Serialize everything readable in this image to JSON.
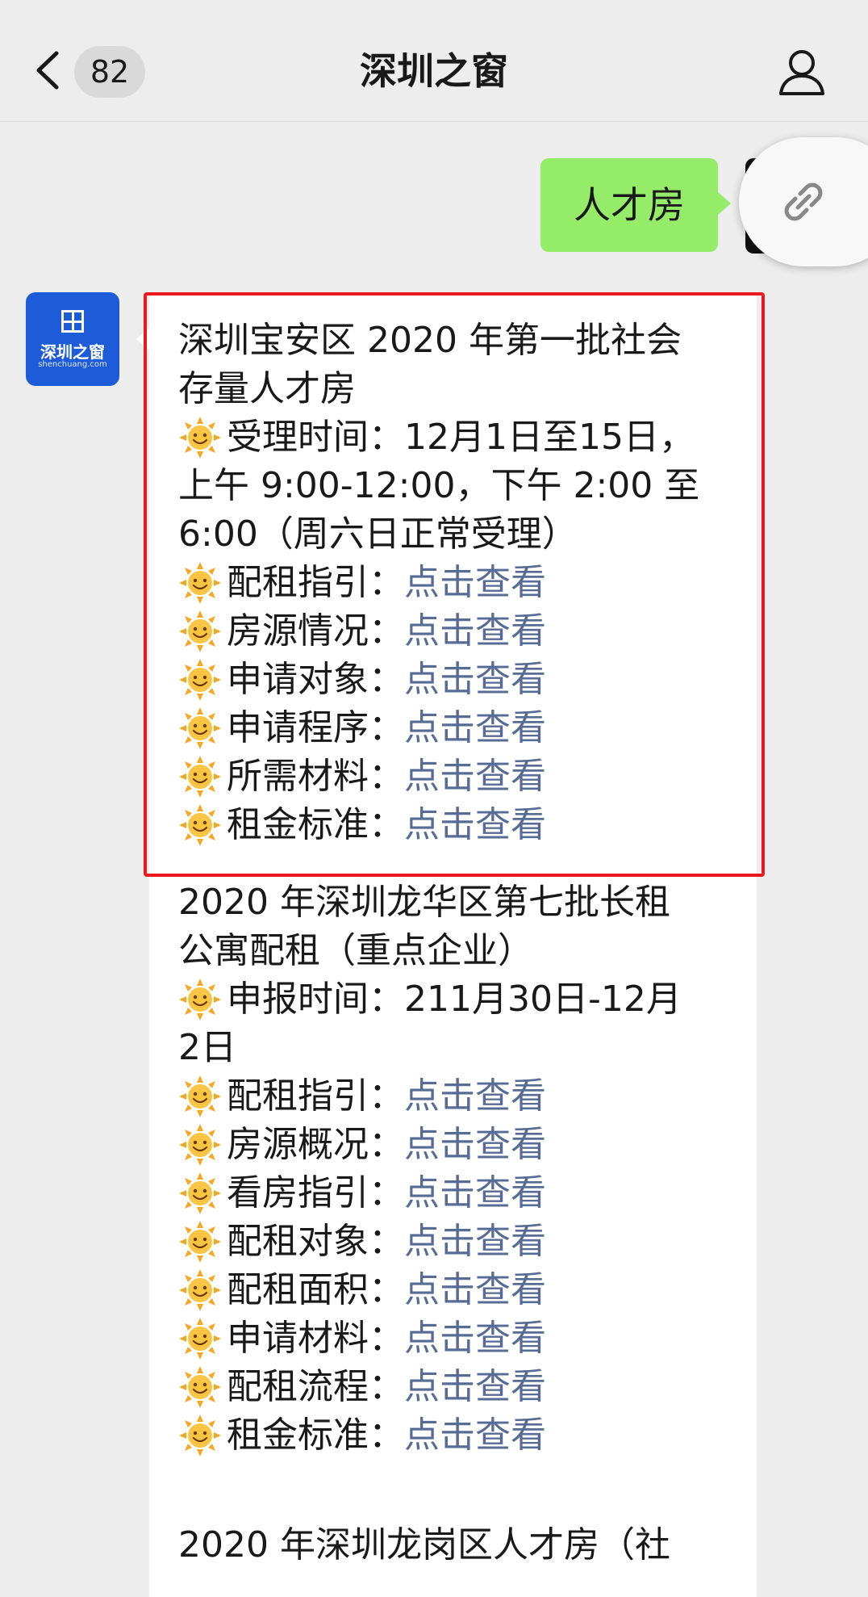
{
  "navbar": {
    "back_count": "82",
    "title": "深圳之窗"
  },
  "user_message": {
    "text": "人才房"
  },
  "bot_avatar": {
    "name": "深圳之窗",
    "sub": "shenchuang.com"
  },
  "bot_message": {
    "section1": {
      "title_lines": [
        "深圳宝安区 2020 年第一批社会",
        "存量人才房"
      ],
      "time_lines": [
        "受理时间：12月1日至15日，",
        "上午 9:00-12:00，下午 2:00 至",
        "6:00（周六日正常受理）"
      ],
      "items": [
        {
          "label": "配租指引：",
          "link": "点击查看"
        },
        {
          "label": "房源情况：",
          "link": "点击查看"
        },
        {
          "label": "申请对象：",
          "link": "点击查看"
        },
        {
          "label": "申请程序：",
          "link": "点击查看"
        },
        {
          "label": "所需材料：",
          "link": "点击查看"
        },
        {
          "label": "租金标准：",
          "link": "点击查看"
        }
      ]
    },
    "section2": {
      "title_lines": [
        "2020 年深圳龙华区第七批长租",
        "公寓配租（重点企业）"
      ],
      "time_lines": [
        "申报时间：211月30日-12月",
        "2日"
      ],
      "items": [
        {
          "label": "配租指引：",
          "link": "点击查看"
        },
        {
          "label": "房源概况：",
          "link": "点击查看"
        },
        {
          "label": "看房指引：",
          "link": "点击查看"
        },
        {
          "label": "配租对象：",
          "link": "点击查看"
        },
        {
          "label": "配租面积：",
          "link": "点击查看"
        },
        {
          "label": "申请材料：",
          "link": "点击查看"
        },
        {
          "label": "配租流程：",
          "link": "点击查看"
        },
        {
          "label": "租金标准：",
          "link": "点击查看"
        }
      ]
    },
    "section3": {
      "title_lines": [
        "2020 年深圳龙岗区人才房（社"
      ]
    }
  },
  "colors": {
    "highlight": "#e8191f",
    "link": "#576b95",
    "user_bubble": "#95ec69",
    "avatar": "#1e5bd8"
  }
}
